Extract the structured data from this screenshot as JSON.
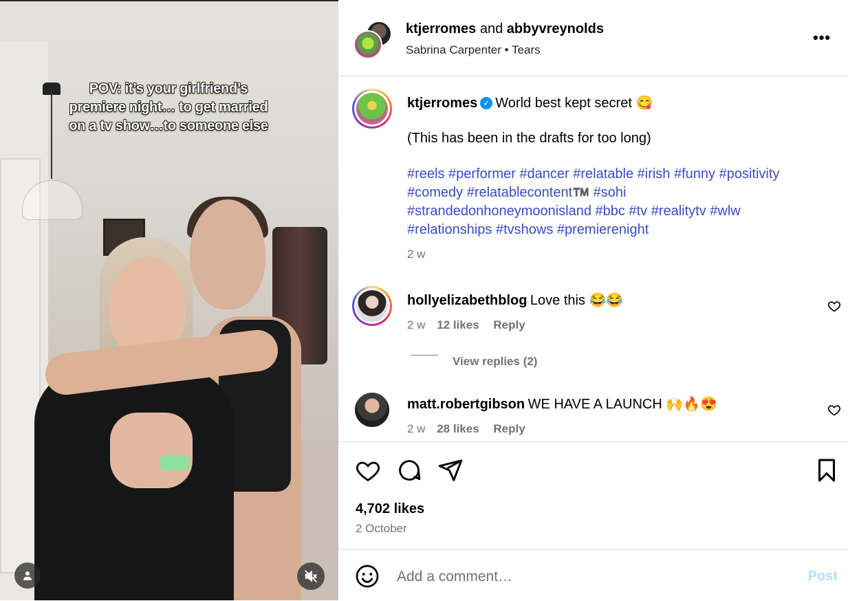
{
  "video": {
    "caption": "POV: it’s your girlfriend’s premiere night… to get married on a tv show…to someone else"
  },
  "header": {
    "user1": "ktjerromes",
    "joiner": "and",
    "user2": "abbyvreynolds",
    "music_artist": "Sabrina Carpenter",
    "music_separator": "•",
    "music_track": "Tears",
    "more_label": "•••"
  },
  "post": {
    "username": "ktjerromes",
    "verified_glyph": "✓",
    "title": "World best kept secret 😋",
    "line2": "(This has been in the drafts for too long)",
    "hashtags_line1": "#reels #performer #dancer #relatable #irish #funny #positivity",
    "hashtags_line2": "#comedy #relatablecontent™️  #sohi",
    "hashtags_line3": "#strandedonhoneymoonisland #bbc #tv #realitytv #wlw",
    "hashtags_line4": "#relationships #tvshows #premierenight",
    "time": "2 w"
  },
  "comments": [
    {
      "username": "hollyelizabethblog",
      "text": "Love this 😂😂",
      "time": "2 w",
      "likes": "12 likes",
      "reply": "Reply",
      "view_replies": "View replies (2)"
    },
    {
      "username": "matt.robertgibson",
      "text": "WE HAVE A LAUNCH 🙌🔥😍",
      "time": "2 w",
      "likes": "28 likes",
      "reply": "Reply"
    }
  ],
  "footer": {
    "likes": "4,702 likes",
    "date": "2 October",
    "add_comment_placeholder": "Add a comment…",
    "post_label": "Post"
  },
  "colors": {
    "link": "#3a4cc3",
    "verified": "#0095f6",
    "post_disabled": "#b2dffc",
    "muted": "#737373"
  },
  "icons": [
    "heart-icon",
    "comment-icon",
    "share-icon",
    "bookmark-icon",
    "emoji-icon",
    "more-icon",
    "tag-people-icon",
    "mute-icon"
  ]
}
